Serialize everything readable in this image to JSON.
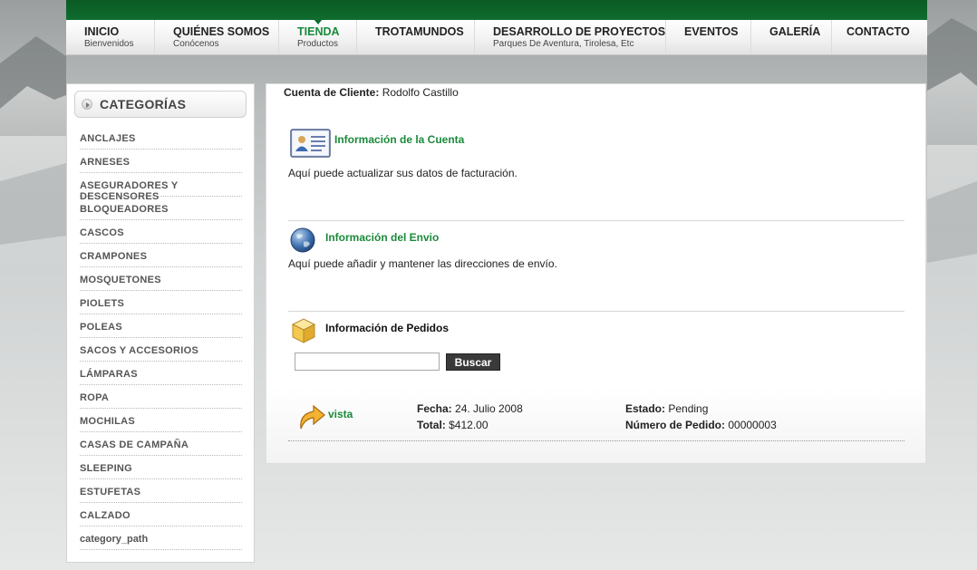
{
  "nav": {
    "items": [
      {
        "title": "INICIO",
        "subtitle": "Bienvenidos"
      },
      {
        "title": "QUIÉNES SOMOS",
        "subtitle": "Conócenos"
      },
      {
        "title": "TIENDA",
        "subtitle": "Productos"
      },
      {
        "title": "TROTAMUNDOS",
        "subtitle": ""
      },
      {
        "title": "DESARROLLO DE PROYECTOS",
        "subtitle": "Parques De Aventura, Tirolesa, Etc"
      },
      {
        "title": "EVENTOS",
        "subtitle": ""
      },
      {
        "title": "GALERÍA",
        "subtitle": ""
      },
      {
        "title": "CONTACTO",
        "subtitle": ""
      }
    ],
    "active_index": 2
  },
  "sidebar": {
    "title": "CATEGORÍAS",
    "items": [
      "ANCLAJES",
      "ARNESES",
      "ASEGURADORES Y DESCENSORES",
      "BLOQUEADORES",
      "CASCOS",
      "CRAMPONES",
      "MOSQUETONES",
      "PIOLETS",
      "POLEAS",
      "SACOS Y ACCESORIOS",
      "LÁMPARAS",
      "ROPA",
      "MOCHILAS",
      "CASAS DE CAMPAÑA",
      "SLEEPING",
      "ESTUFETAS",
      "CALZADO",
      "category_path"
    ]
  },
  "account": {
    "client_label": "Cuenta de Cliente:",
    "client_name": "Rodolfo Castillo",
    "account_info": {
      "title": "Información de la Cuenta",
      "desc": "Aquí puede actualizar sus datos de facturación.",
      "icon": "user-card-icon"
    },
    "shipping_info": {
      "title": "Información del Envio",
      "desc": "Aquí puede añadir y mantener las direcciones de envío.",
      "icon": "globe-icon"
    },
    "orders_info": {
      "title": "Información de Pedidos",
      "icon": "box-icon"
    }
  },
  "search": {
    "value": "",
    "button_label": "Buscar"
  },
  "order": {
    "view_label": "vista",
    "date_label": "Fecha:",
    "date_value": "24. Julio 2008",
    "total_label": "Total:",
    "total_value": "$412.00",
    "status_label": "Estado:",
    "status_value": "Pending",
    "number_label": "Número de Pedido:",
    "number_value": "00000003"
  },
  "colors": {
    "brand_green": "#0f6d2e",
    "link_green": "#1a8a3a"
  }
}
